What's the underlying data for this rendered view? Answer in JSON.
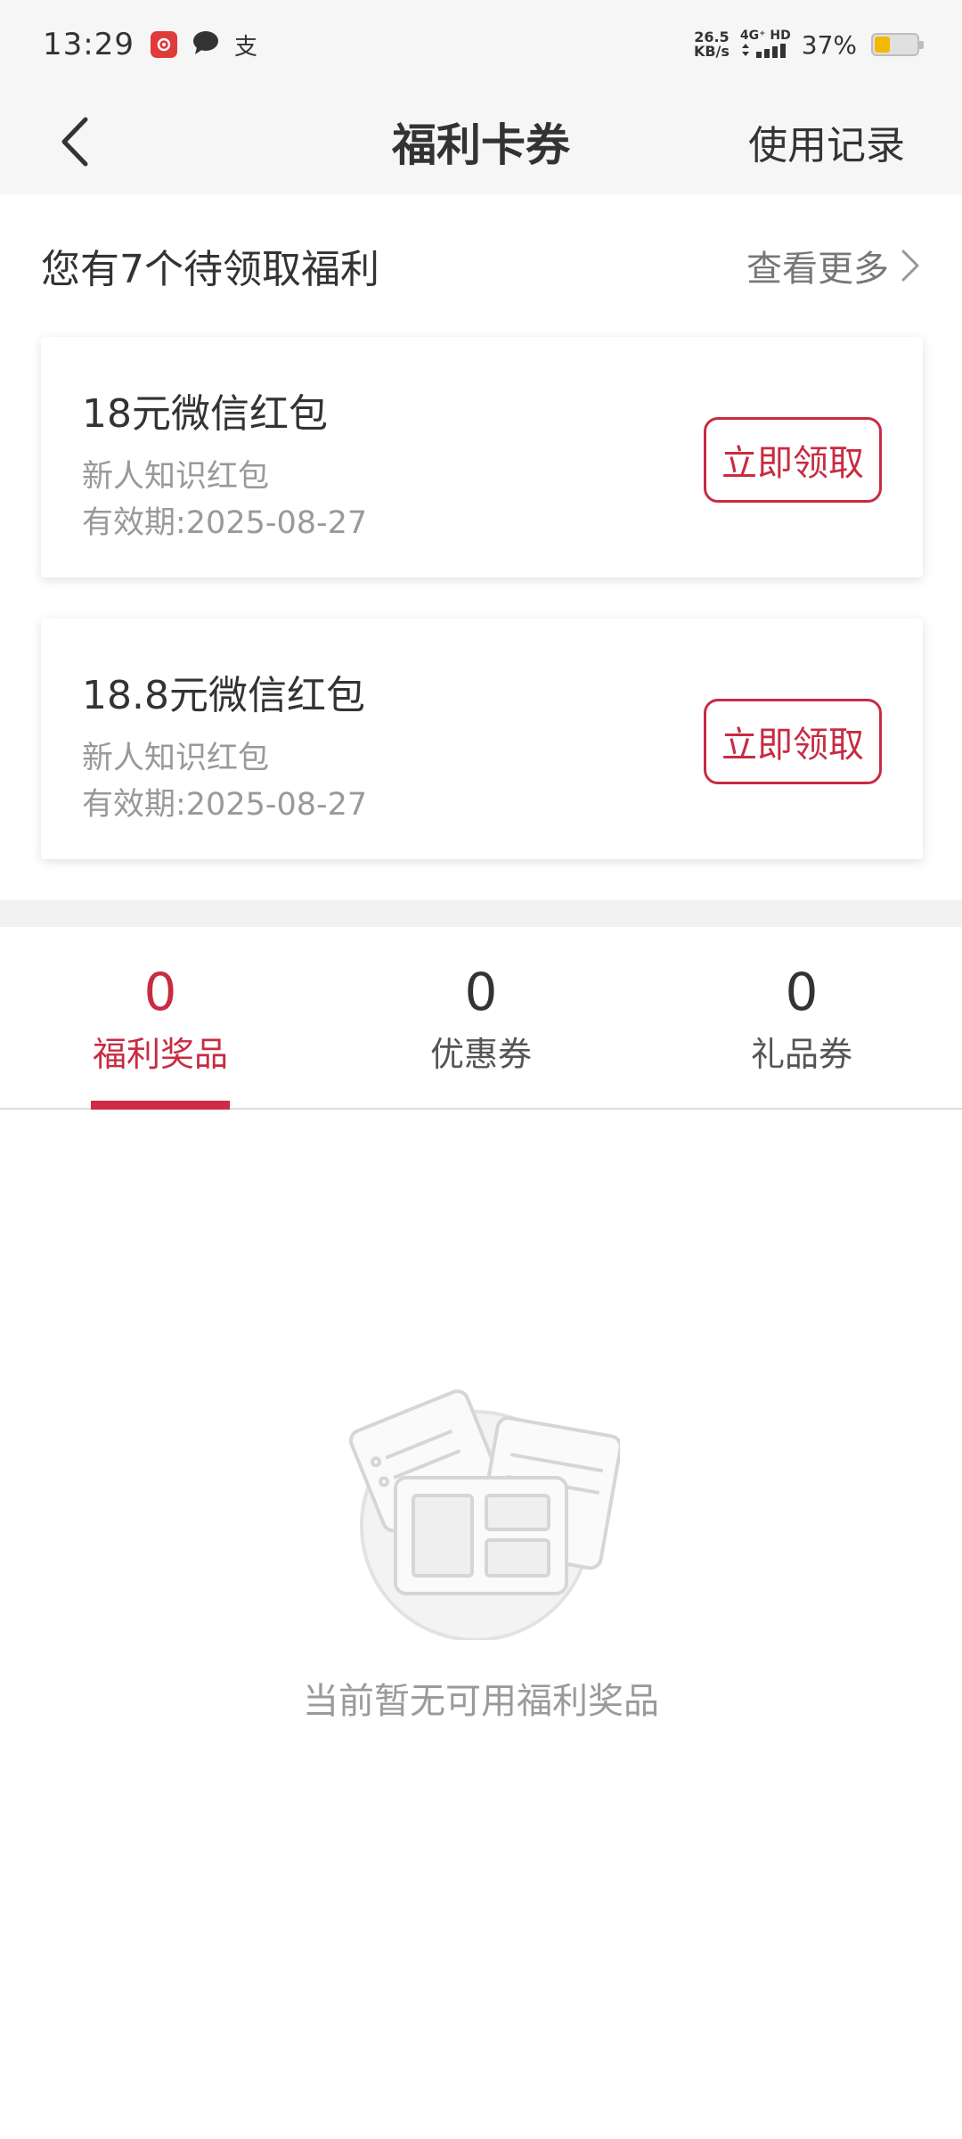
{
  "status_bar": {
    "time": "13:29",
    "net_speed_value": "26.5",
    "net_speed_unit": "KB/s",
    "network_type": "4G⁺ HD",
    "battery_percent": "37%",
    "battery_level": 0.37,
    "battery_color": "#f5b800",
    "left_icons": [
      "netease-music-icon",
      "chat-bubble-icon",
      "alipay-icon"
    ],
    "alipay_glyph": "支"
  },
  "nav": {
    "back_icon": "chevron-left-icon",
    "title": "福利卡券",
    "action_label": "使用记录"
  },
  "pending": {
    "title": "您有7个待领取福利",
    "see_more_label": "查看更多"
  },
  "coupons": [
    {
      "title": "18元微信红包",
      "subtitle": "新人知识红包",
      "validity": "有效期:2025-08-27",
      "button_label": "立即领取"
    },
    {
      "title": "18.8元微信红包",
      "subtitle": "新人知识红包",
      "validity": "有效期:2025-08-27",
      "button_label": "立即领取"
    }
  ],
  "tabs": [
    {
      "count": "0",
      "label": "福利奖品",
      "active": true
    },
    {
      "count": "0",
      "label": "优惠券",
      "active": false
    },
    {
      "count": "0",
      "label": "礼品券",
      "active": false
    }
  ],
  "empty_state": {
    "icon": "empty-coupons-illustration-icon",
    "message": "当前暂无可用福利奖品"
  },
  "colors": {
    "accent": "#c72c42",
    "header_bg": "#f6f6f6",
    "muted_text": "#999999"
  }
}
